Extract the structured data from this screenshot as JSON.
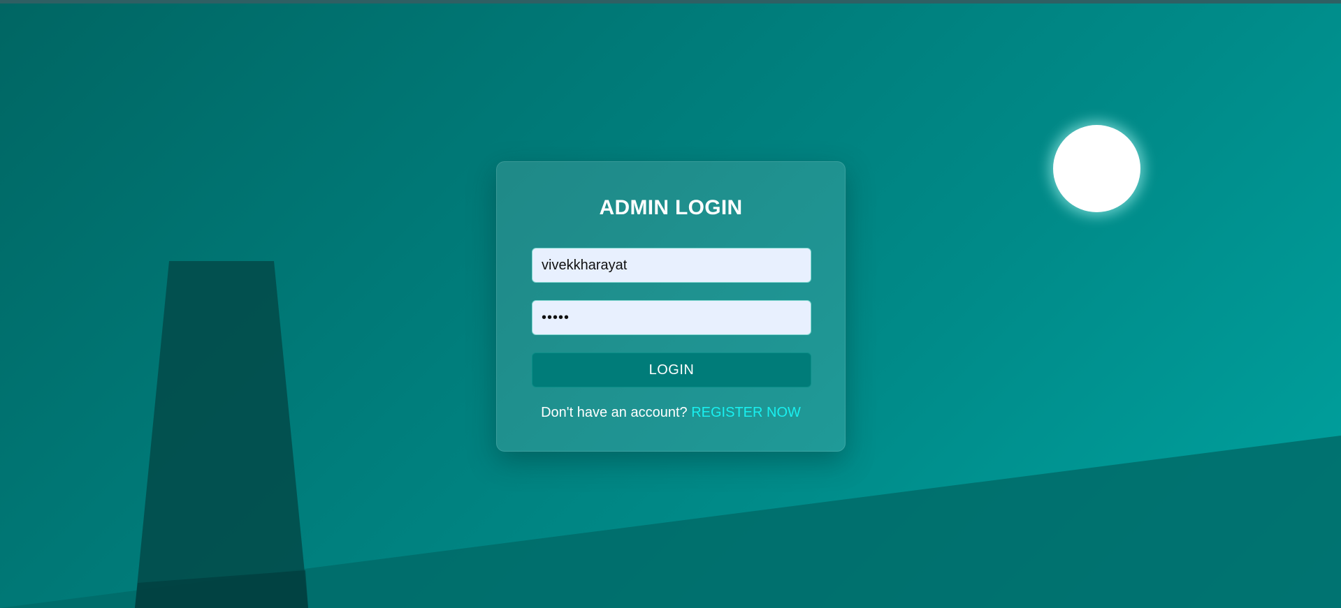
{
  "colors": {
    "background_dark": "#006663",
    "background_light": "#00a3a0",
    "ground": "#006b69",
    "tower": "#024a49",
    "moon": "#ffffff",
    "card_bg": "rgba(255,255,255,0.12)",
    "field_bg": "#e8f0fe",
    "button_bg": "#007c79",
    "link": "#19f0f0"
  },
  "login_card": {
    "title": "ADMIN LOGIN",
    "username_value": "vivekkharayat",
    "password_value": "•••••",
    "login_label": "LOGIN",
    "register_prompt": "Don't have an account?",
    "register_link": "REGISTER NOW"
  }
}
